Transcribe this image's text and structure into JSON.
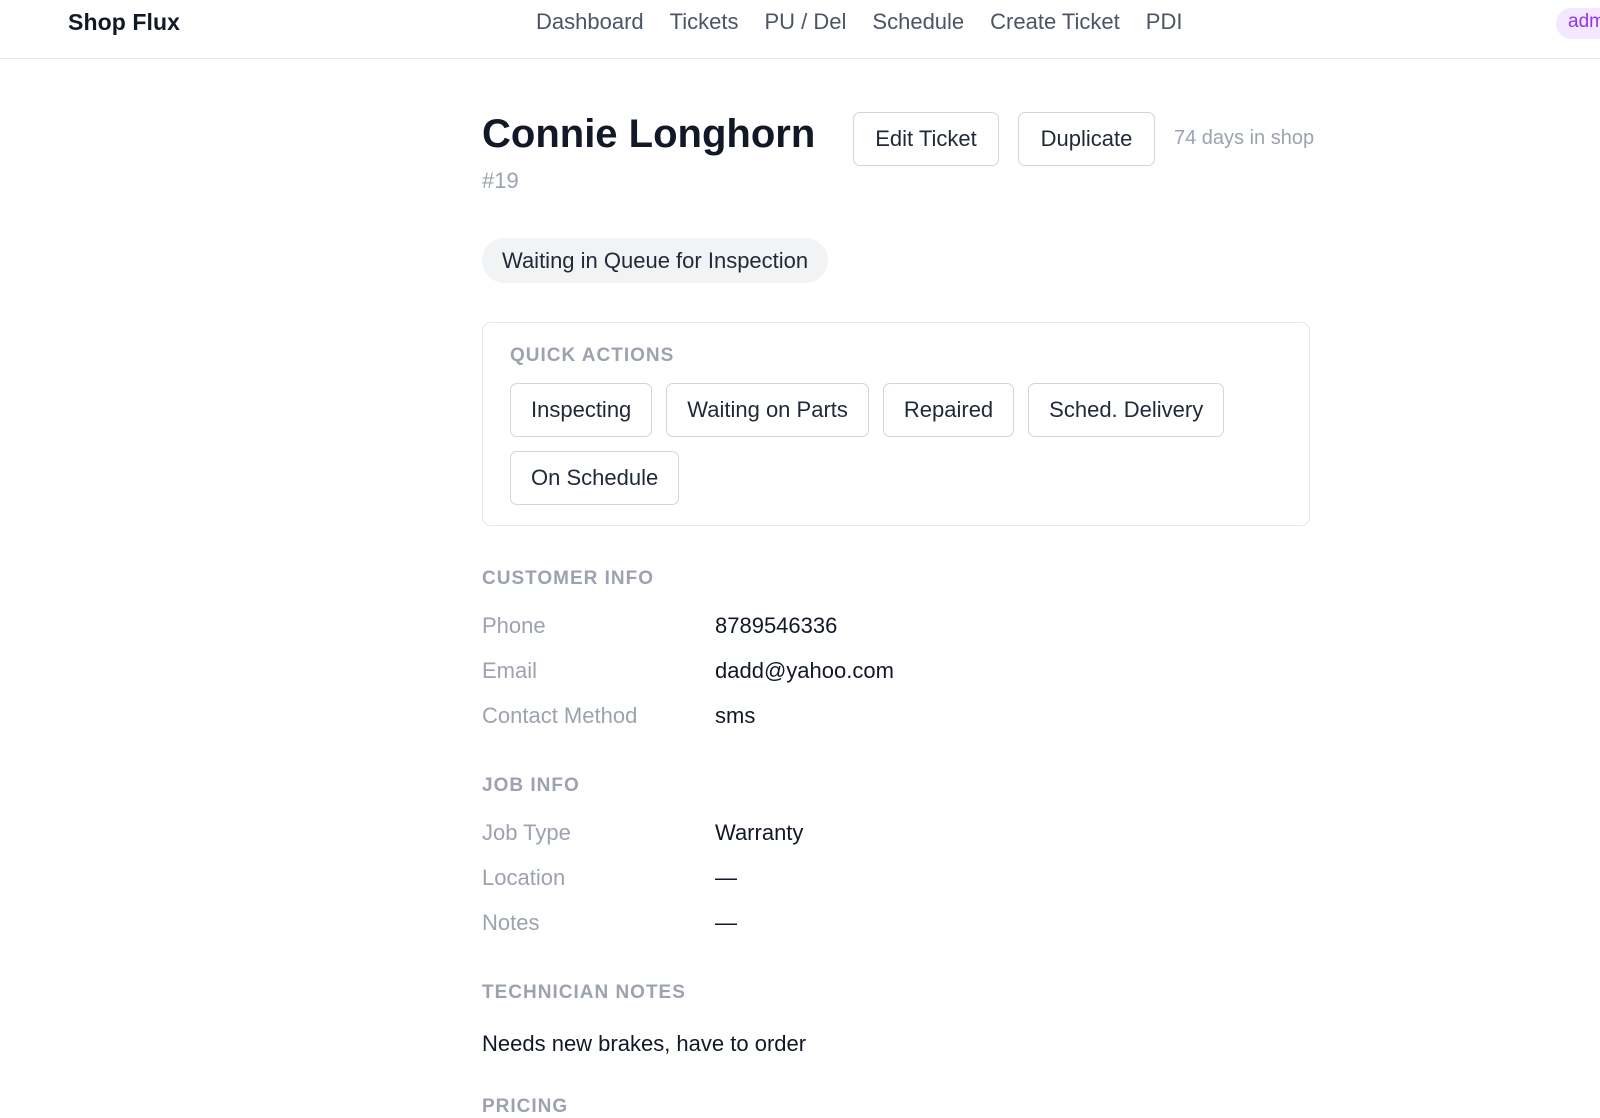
{
  "app": {
    "brand": "Shop Flux",
    "nav": [
      "Dashboard",
      "Tickets",
      "PU / Del",
      "Schedule",
      "Create Ticket",
      "PDI"
    ],
    "role_badge": "admin"
  },
  "ticket": {
    "customer_name": "Connie Longhorn",
    "number": "#19",
    "days_in_shop": "74 days in shop",
    "status": "Waiting in Queue for Inspection",
    "edit_label": "Edit Ticket",
    "duplicate_label": "Duplicate"
  },
  "quick_actions": {
    "heading": "QUICK ACTIONS",
    "buttons": [
      "Inspecting",
      "Waiting on Parts",
      "Repaired",
      "Sched. Delivery",
      "On Schedule"
    ]
  },
  "customer_info": {
    "heading": "CUSTOMER INFO",
    "rows": [
      {
        "label": "Phone",
        "value": "8789546336"
      },
      {
        "label": "Email",
        "value": "dadd@yahoo.com"
      },
      {
        "label": "Contact Method",
        "value": "sms"
      }
    ]
  },
  "job_info": {
    "heading": "JOB INFO",
    "rows": [
      {
        "label": "Job Type",
        "value": "Warranty"
      },
      {
        "label": "Location",
        "value": "—"
      },
      {
        "label": "Notes",
        "value": "—"
      }
    ]
  },
  "technician_notes": {
    "heading": "TECHNICIAN NOTES",
    "text": "Needs new brakes, have to order"
  },
  "pricing": {
    "heading": "PRICING"
  }
}
